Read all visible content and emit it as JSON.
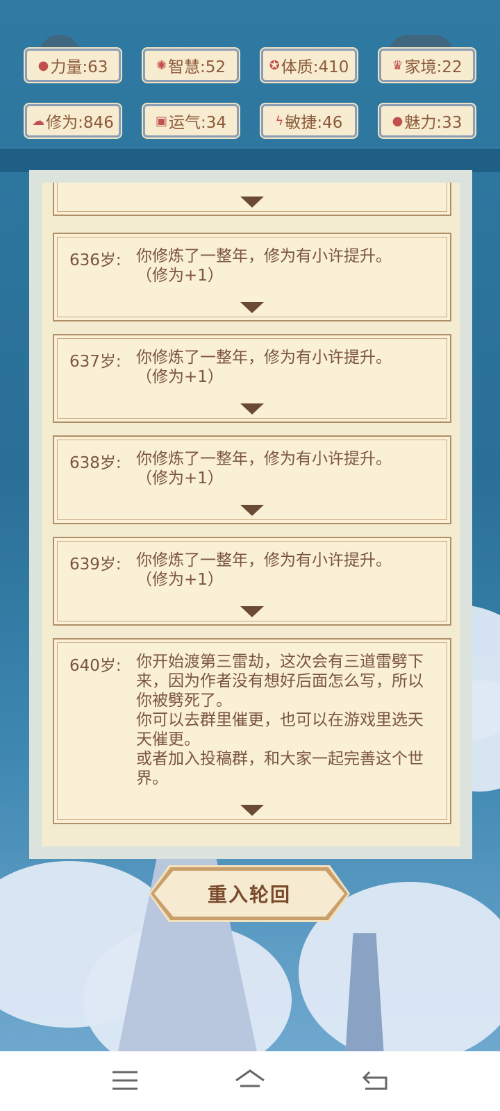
{
  "header": {
    "back_icon": "chevron-left-icon",
    "menu_icon": "more-dots-icon"
  },
  "stats": [
    {
      "icon": "strength-icon",
      "label": "力量:63"
    },
    {
      "icon": "wisdom-icon",
      "label": "智慧:52"
    },
    {
      "icon": "physique-icon",
      "label": "体质:410"
    },
    {
      "icon": "family-icon",
      "label": "家境:22"
    },
    {
      "icon": "cultivation-icon",
      "label": "修为:846"
    },
    {
      "icon": "luck-icon",
      "label": "运气:34"
    },
    {
      "icon": "agility-icon",
      "label": "敏捷:46"
    },
    {
      "icon": "charm-icon",
      "label": "魅力:33"
    }
  ],
  "log": [
    {
      "age": "636岁:",
      "text": "你修炼了一整年，修为有小许提升。",
      "sub": "（修为+1）"
    },
    {
      "age": "637岁:",
      "text": "你修炼了一整年，修为有小许提升。",
      "sub": "（修为+1）"
    },
    {
      "age": "638岁:",
      "text": "你修炼了一整年，修为有小许提升。",
      "sub": "（修为+1）"
    },
    {
      "age": "639岁:",
      "text": "你修炼了一整年，修为有小许提升。",
      "sub": "（修为+1）"
    },
    {
      "age": "640岁:",
      "text": "你开始渡第三雷劫，这次会有三道雷劈下来，因为作者没有想好后面怎么写，所以你被劈死了。\n你可以去群里催更，也可以在游戏里选天天催更。\n或者加入投稿群，和大家一起完善这个世界。",
      "sub": ""
    }
  ],
  "reborn_button": "重入轮回",
  "nav": {
    "menu_icon": "menu-icon",
    "home_icon": "home-icon",
    "back_icon": "back-icon"
  },
  "colors": {
    "sky": "#2a6f96",
    "card": "#faf0d6",
    "card_border": "#b08e66",
    "text": "#7a5540",
    "stat_icon": "#c0504d"
  }
}
